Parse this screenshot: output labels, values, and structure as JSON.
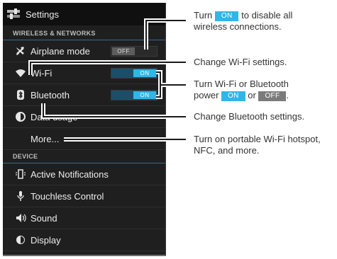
{
  "app": {
    "title": "Settings",
    "icon": "settings-sliders-icon"
  },
  "sections": {
    "wireless": "WIRELESS & NETWORKS",
    "device": "DEVICE"
  },
  "rows": {
    "airplane": {
      "label": "Airplane mode",
      "icon": "airplane-icon",
      "toggle": "OFF"
    },
    "wifi": {
      "label": "Wi-Fi",
      "icon": "wifi-icon",
      "toggle": "ON"
    },
    "bluetooth": {
      "label": "Bluetooth",
      "icon": "bluetooth-icon",
      "toggle": "ON"
    },
    "data": {
      "label": "Data usage",
      "icon": "pie-chart-icon"
    },
    "more": {
      "label": "More..."
    },
    "notifications": {
      "label": "Active Notifications",
      "icon": "phone-vibrate-icon"
    },
    "touchless": {
      "label": "Touchless Control",
      "icon": "microphone-icon"
    },
    "sound": {
      "label": "Sound",
      "icon": "speaker-icon"
    },
    "display": {
      "label": "Display",
      "icon": "brightness-icon"
    }
  },
  "callouts": {
    "airplane": {
      "pre": "Turn",
      "pill": "ON",
      "post": "to disable all",
      "line2": "wireless connections."
    },
    "wifi": "Change Wi-Fi settings.",
    "power": {
      "line1": "Turn Wi-Fi or Bluetooth",
      "pre": "power",
      "pill_on": "ON",
      "mid": "or",
      "pill_off": "OFF",
      "post": "."
    },
    "bluetooth": "Change Bluetooth settings.",
    "more": {
      "line1": "Turn on portable Wi-Fi hotspot,",
      "line2": "NFC, and more."
    }
  },
  "colors": {
    "accent": "#33b5e5",
    "screen_bg": "#1f1f1f",
    "toggle_off": "#5d5d5d"
  }
}
